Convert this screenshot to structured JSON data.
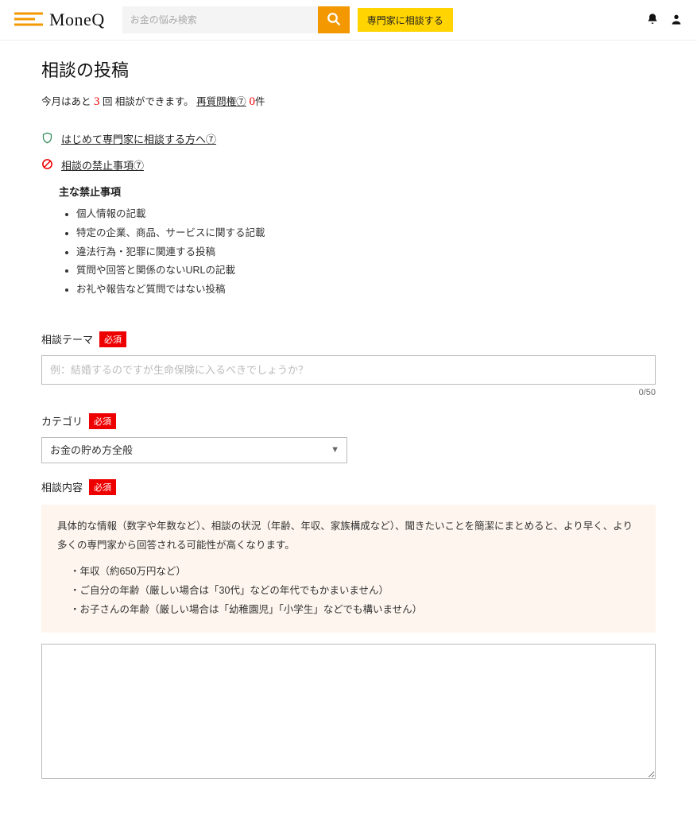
{
  "header": {
    "brand": "MoneQ",
    "search_placeholder": "お金の悩み検索",
    "consult_btn": "専門家に相談する"
  },
  "page_title": "相談の投稿",
  "month_line": {
    "prefix": "今月はあと ",
    "count": "3",
    "suffix": " 回 相談ができます。",
    "requestion_label": "再質問権⑦",
    "requestion_count": " 0",
    "requestion_unit": "件"
  },
  "first_time_link": "はじめて専門家に相談する方へ⑦",
  "prohibited_link": "相談の禁止事項⑦",
  "prohibited_heading": "主な禁止事項",
  "prohibited_items": [
    "個人情報の記載",
    "特定の企業、商品、サービスに関する記載",
    "違法行為・犯罪に関連する投稿",
    "質問や回答と関係のないURLの記載",
    "お礼や報告など質問ではない投稿"
  ],
  "theme": {
    "label": "相談テーマ",
    "required": "必須",
    "placeholder": "例：結婚するのですが生命保険に入るべきでしょうか？",
    "counter": "0/50"
  },
  "category": {
    "label": "カテゴリ",
    "required": "必須",
    "selected": "お金の貯め方全般"
  },
  "content": {
    "label": "相談内容",
    "required": "必須",
    "hint_intro": "具体的な情報（数字や年数など）、相談の状況（年齢、年収、家族構成など）、聞きたいことを簡潔にまとめると、より早く、より多くの専門家から回答される可能性が高くなります。",
    "hints": [
      "・年収（約650万円など）",
      "・ご自分の年齢（厳しい場合は「30代」などの年代でもかまいません）",
      "・お子さんの年齢（厳しい場合は「幼稚園児」「小学生」などでも構いません）"
    ]
  }
}
